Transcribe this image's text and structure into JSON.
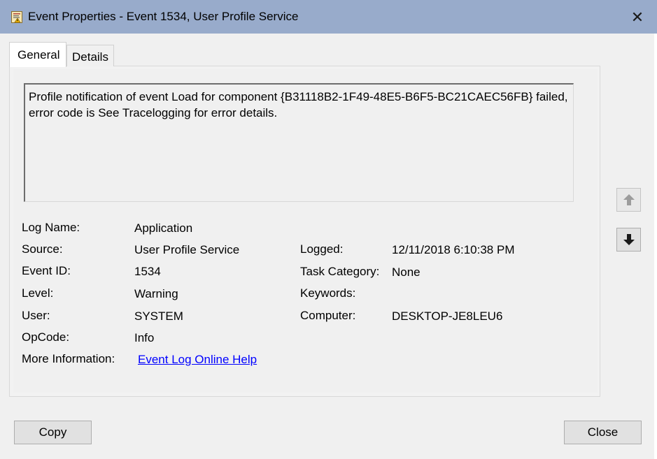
{
  "window": {
    "title": "Event Properties - Event 1534, User Profile Service",
    "icon": "event-viewer-icon",
    "close_glyph": "✕"
  },
  "tabs": [
    {
      "label": "General",
      "selected": true
    },
    {
      "label": "Details",
      "selected": false
    }
  ],
  "description": "Profile notification of event Load for component {B31118B2-1F49-48E5-B6F5-BC21CAEC56FB} failed, error code is See Tracelogging for error details.",
  "fields": {
    "log_name": {
      "label": "Log Name:",
      "value": "Application"
    },
    "source": {
      "label": "Source:",
      "value": "User Profile Service"
    },
    "event_id": {
      "label": "Event ID:",
      "value": "1534"
    },
    "level": {
      "label": "Level:",
      "value": "Warning"
    },
    "user": {
      "label": "User:",
      "value": "SYSTEM"
    },
    "opcode": {
      "label": "OpCode:",
      "value": "Info"
    },
    "more_info": {
      "label": "More Information:",
      "value": "Event Log Online Help"
    },
    "logged": {
      "label": "Logged:",
      "value": "12/11/2018 6:10:38 PM"
    },
    "task_category": {
      "label": "Task Category:",
      "value": "None"
    },
    "keywords": {
      "label": "Keywords:",
      "value": ""
    },
    "computer": {
      "label": "Computer:",
      "value": "DESKTOP-JE8LEU6"
    }
  },
  "nav": {
    "previous_icon": "arrow-up-icon",
    "next_icon": "arrow-down-icon",
    "previous_enabled": false
  },
  "buttons": {
    "copy": "Copy",
    "close": "Close"
  },
  "colors": {
    "titlebar": "#98abcb",
    "link": "#0000ff"
  }
}
